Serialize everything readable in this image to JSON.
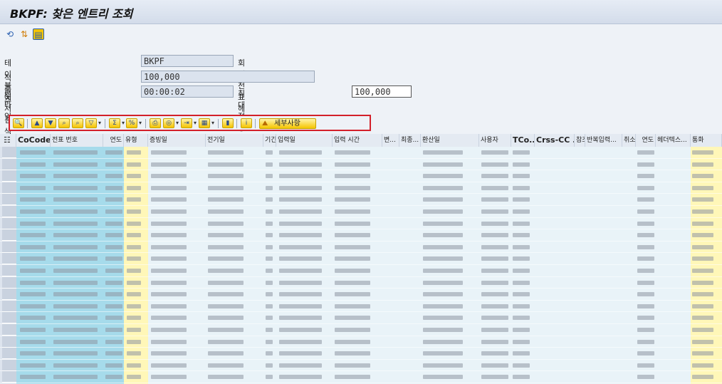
{
  "title": "BKPF: 찾은 엔트리 조회",
  "app_toolbar": {
    "icons": [
      "refresh-icon",
      "select-icon",
      "display-icon"
    ]
  },
  "form": {
    "table_label": "테이블에서 검색",
    "table_value": "BKPF",
    "table_desc": "회계 전표 헤더",
    "hits_label": "적중 수",
    "hits_value": "100,000",
    "runtime_label": "런타임",
    "runtime_value": "00:00:02",
    "maxhits_label": "최대 적중 수",
    "maxhits_value": "100,000"
  },
  "alv_toolbar": {
    "buttons": [
      "details-icon",
      "sort-asc-icon",
      "sort-desc-icon",
      "find-icon",
      "find-next-icon",
      "filter-icon",
      "sum-icon",
      "subtotal-icon",
      "print-icon",
      "view-icon",
      "export-icon",
      "layout-icon",
      "graphic-icon",
      "info-icon"
    ],
    "detail_label": "세부사항"
  },
  "columns": [
    "CoCode",
    "전표 번호",
    "연도",
    "유형",
    "증빙일",
    "전기일",
    "기긴",
    "입력일",
    "입력 시간",
    "변...",
    "최종...",
    "환산일",
    "사용자",
    "TCo...",
    "Crss-CC ...",
    "참조",
    "반복입력...",
    "취소",
    "연도",
    "헤더텍스...",
    "통화"
  ]
}
